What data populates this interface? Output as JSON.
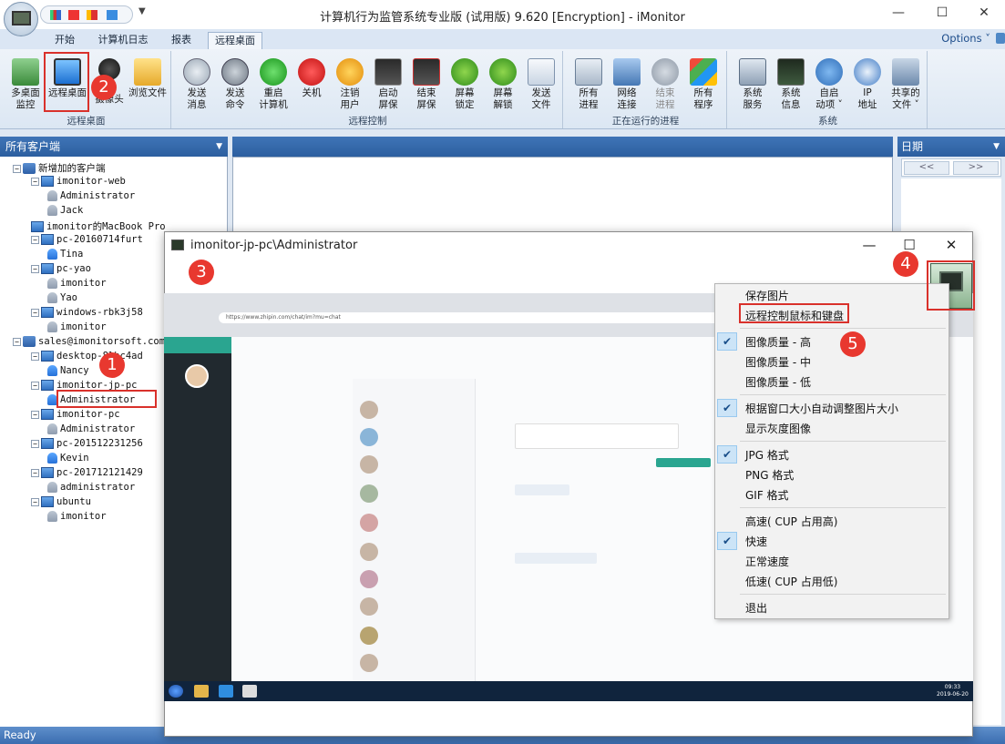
{
  "window": {
    "title": "计算机行为监管系统专业版 (试用版) 9.620 [Encryption] - iMonitor",
    "minimize": "—",
    "maximize": "☐",
    "close": "✕"
  },
  "ribbon_tabs": [
    "开始",
    "计算机日志",
    "报表",
    "远程桌面"
  ],
  "options_label": "Options ˅",
  "groups": {
    "remote_desktop": {
      "label": "远程桌面",
      "buttons": [
        "多桌面\n监控",
        "远程桌面",
        "\n摄像头",
        "浏览文件"
      ]
    },
    "remote_control": {
      "label": "远程控制",
      "buttons": [
        "发送\n消息",
        "发送\n命令",
        "重启\n计算机",
        "关机",
        "注销\n用户",
        "启动\n屏保",
        "结束\n屏保",
        "屏幕\n锁定",
        "屏幕\n解锁",
        "发送\n文件"
      ]
    },
    "running": {
      "label": "正在运行的进程",
      "buttons": [
        "所有\n进程",
        "网络\n连接",
        "结束\n进程",
        "所有\n程序"
      ]
    },
    "system": {
      "label": "系统",
      "buttons": [
        "系统\n服务",
        "系统\n信息",
        "自启\n动项 ˅",
        "IP\n地址",
        "共享的\n文件 ˅"
      ]
    }
  },
  "left_panel": {
    "header": "所有客户端",
    "tree": [
      {
        "label": "新增加的客户端",
        "type": "net",
        "exp": "−"
      },
      {
        "label": "imonitor-web",
        "type": "pc",
        "exp": "−"
      },
      {
        "label": "Administrator",
        "type": "user"
      },
      {
        "label": "Jack",
        "type": "user"
      },
      {
        "label": "imonitor的MacBook Pro",
        "type": "pc"
      },
      {
        "label": "pc-20160714furt",
        "type": "pc",
        "exp": "−"
      },
      {
        "label": "Tina",
        "type": "user-on"
      },
      {
        "label": "pc-yao",
        "type": "pc",
        "exp": "−"
      },
      {
        "label": "imonitor",
        "type": "user"
      },
      {
        "label": "Yao",
        "type": "user"
      },
      {
        "label": "windows-rbk3j58",
        "type": "pc",
        "exp": "−"
      },
      {
        "label": "imonitor",
        "type": "user"
      },
      {
        "label": "sales@imonitorsoft.com",
        "type": "net",
        "exp": "−"
      },
      {
        "label": "desktop-8lhc4ad",
        "type": "pc",
        "exp": "−"
      },
      {
        "label": "Nancy",
        "type": "user-on"
      },
      {
        "label": "imonitor-jp-pc",
        "type": "pc",
        "exp": "−"
      },
      {
        "label": "Administrator",
        "type": "user-on"
      },
      {
        "label": "imonitor-pc",
        "type": "pc",
        "exp": "−"
      },
      {
        "label": "Administrator",
        "type": "user"
      },
      {
        "label": "pc-201512231256",
        "type": "pc",
        "exp": "−"
      },
      {
        "label": "Kevin",
        "type": "user-on"
      },
      {
        "label": "pc-201712121429",
        "type": "pc",
        "exp": "−"
      },
      {
        "label": "administrator",
        "type": "user"
      },
      {
        "label": "ubuntu",
        "type": "pc",
        "exp": "−"
      },
      {
        "label": "imonitor",
        "type": "user"
      }
    ]
  },
  "right_panel": {
    "header": "日期",
    "prev": "<<",
    "next": ">>"
  },
  "status": "Ready",
  "remote_window": {
    "title": "imonitor-jp-pc\\Administrator",
    "address": "https://www.zhipin.com/chat/im?mu=chat",
    "clock": "09:33\n2019-06-20"
  },
  "context_menu": {
    "items": [
      {
        "label": "保存图片",
        "checked": false
      },
      {
        "label": "远程控制鼠标和键盘",
        "checked": false
      },
      {
        "label": "图像质量 - 高",
        "checked": true
      },
      {
        "label": "图像质量 - 中",
        "checked": false
      },
      {
        "label": "图像质量 - 低",
        "checked": false
      },
      {
        "label": "根据窗口大小自动调整图片大小",
        "checked": true
      },
      {
        "label": "显示灰度图像",
        "checked": false
      },
      {
        "label": "JPG 格式",
        "checked": true
      },
      {
        "label": "PNG 格式",
        "checked": false
      },
      {
        "label": "GIF 格式",
        "checked": false
      },
      {
        "label": "高速( CUP 占用高)",
        "checked": false
      },
      {
        "label": "快速",
        "checked": true
      },
      {
        "label": "正常速度",
        "checked": false
      },
      {
        "label": "低速( CUP 占用低)",
        "checked": false
      },
      {
        "label": "退出",
        "checked": false
      }
    ]
  },
  "markers": [
    "1",
    "2",
    "3",
    "4",
    "5"
  ],
  "colors": {
    "accent": "#2c5f9f",
    "annotation": "#e8382f",
    "ribbon": "#dce7f3"
  }
}
